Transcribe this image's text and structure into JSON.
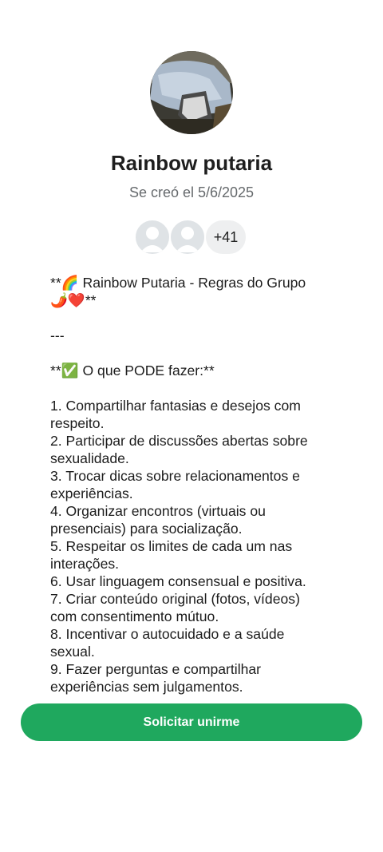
{
  "group": {
    "name": "Rainbow putaria",
    "created": "Se creó el 5/6/2025"
  },
  "members": {
    "extra_count": "+41"
  },
  "description": {
    "lines": [
      "**🌈 Rainbow Putaria - Regras do Grupo",
      "🌶️❤️**",
      "",
      "---",
      "",
      "**✅ O que PODE fazer:**",
      "",
      "1. Compartilhar fantasias e desejos com",
      "respeito.",
      "2. Participar de discussões abertas sobre",
      "sexualidade.",
      "3. Trocar dicas sobre relacionamentos e",
      "experiências.",
      "4. Organizar encontros (virtuais ou",
      "presenciais) para socialização.",
      "5. Respeitar os limites de cada um nas",
      "interações.",
      "6. Usar linguagem consensual e positiva.",
      "7. Criar conteúdo original (fotos, vídeos)",
      "com consentimento mútuo.",
      "8. Incentivar o autocuidado e a saúde",
      "sexual.",
      "9. Fazer perguntas e compartilhar",
      "experiências sem julgamentos."
    ]
  },
  "actions": {
    "join_label": "Solicitar unirme"
  },
  "colors": {
    "accent": "#1fa85e"
  }
}
